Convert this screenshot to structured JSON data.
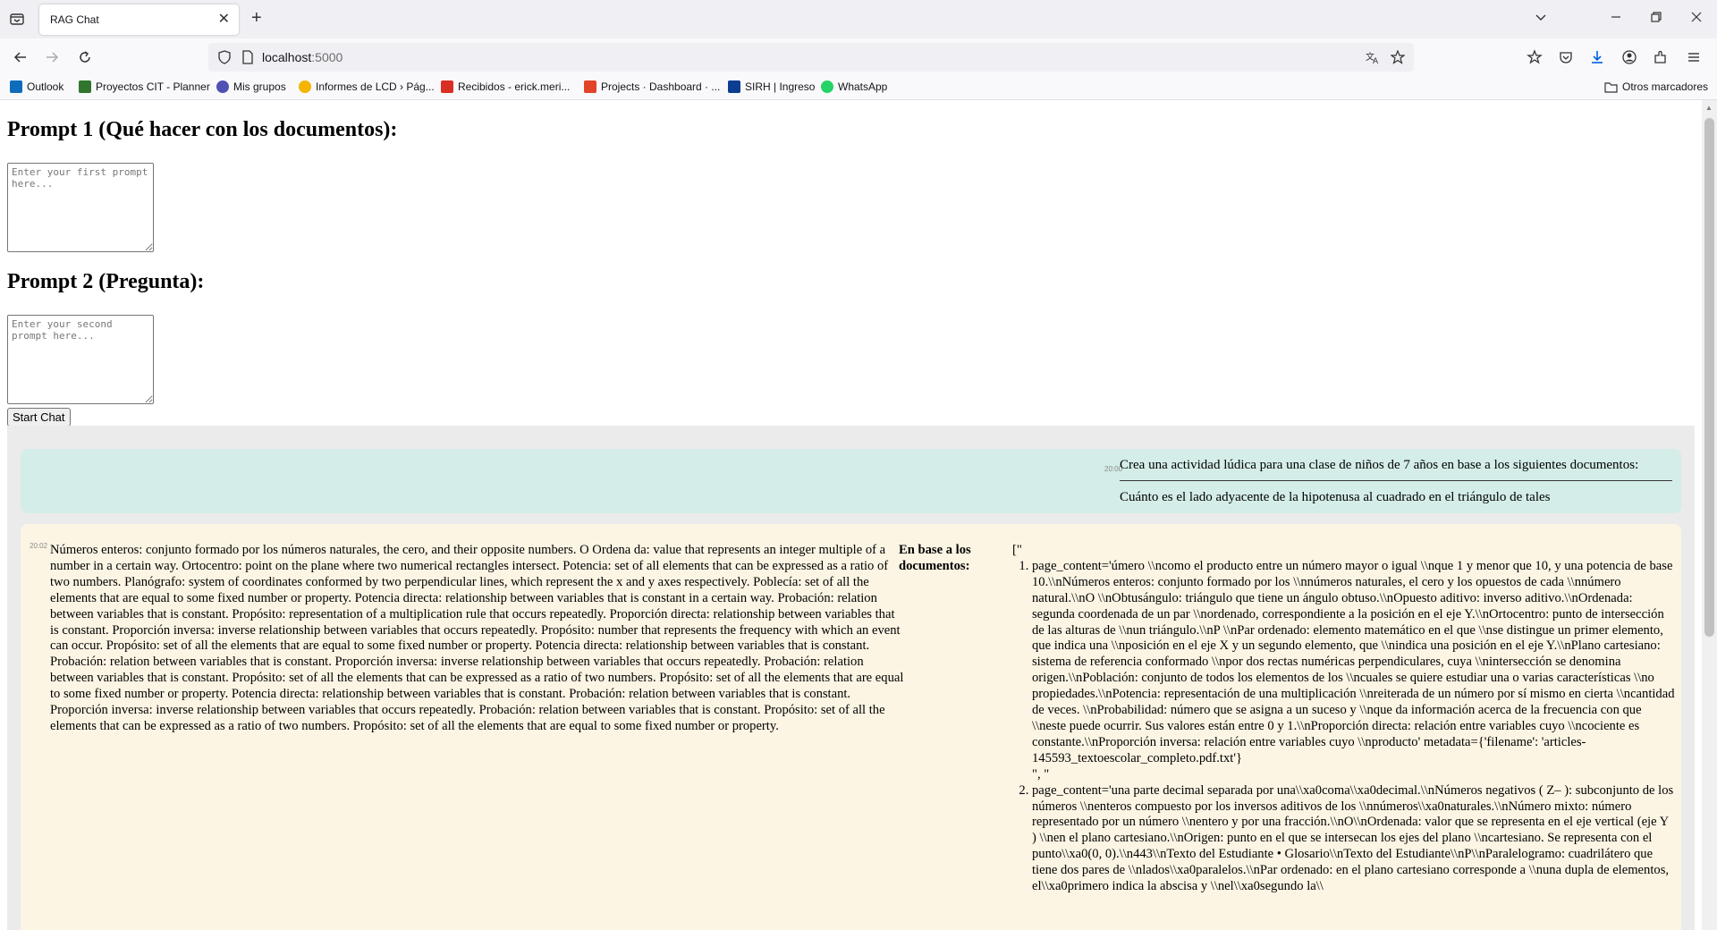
{
  "browser": {
    "tab_title": "RAG Chat",
    "url_host": "localhost",
    "url_port": ":5000",
    "bookmarks": [
      {
        "label": "Outlook",
        "icon": "outlook-icon",
        "color": "#0f6cbd"
      },
      {
        "label": "Proyectos CIT - Planner",
        "icon": "planner-icon",
        "color": "#31752f"
      },
      {
        "label": "Mis grupos",
        "icon": "groups-icon",
        "color": "#4f52b2"
      },
      {
        "label": "Informes de LCD › Pág...",
        "icon": "looker-icon",
        "color": "#f4b400"
      },
      {
        "label": "Recibidos - erick.meri...",
        "icon": "gmail-icon",
        "color": "#d93025"
      },
      {
        "label": "Projects · Dashboard · ...",
        "icon": "gitlab-icon",
        "color": "#e24329"
      },
      {
        "label": "SIRH | Ingreso",
        "icon": "sirh-icon",
        "color": "#0b3d91"
      },
      {
        "label": "WhatsApp",
        "icon": "whatsapp-icon",
        "color": "#25d366"
      }
    ],
    "other_bookmarks": "Otros marcadores"
  },
  "form": {
    "prompt1_label": "Prompt 1 (Qué hacer con los documentos):",
    "prompt1_placeholder": "Enter your first prompt here...",
    "prompt2_label": "Prompt 2 (Pregunta):",
    "prompt2_placeholder": "Enter your second prompt here...",
    "start_button": "Start Chat"
  },
  "chat": {
    "user_message": {
      "time": "20:00",
      "line1": "Crea una actividad lúdica para una clase de niños de 7 años en base a los siguientes documentos:",
      "line2": "Cuánto es el lado adyacente de la hipotenusa al cuadrado en el triángulo de tales"
    },
    "bot_message": {
      "time": "20:02",
      "answer": "Números enteros: conjunto formado por los números naturales, the cero, and their opposite numbers. O Ordena da: value that represents an integer multiple of a number in a certain way. Ortocentro: point on the plane where two numerical rectangles intersect. Potencia: set of all elements that can be expressed as a ratio of two numbers. Planógrafo: system of coordinates conformed by two perpendicular lines, which represent the x and y axes respectively. Poblecía: set of all the elements that are equal to some fixed number or property. Potencia directa: relationship between variables that is constant in a certain way. Probación: relation between variables that is constant. Propósito: representation of a multiplication rule that occurs repeatedly. Proporción directa: relationship between variables that is constant. Proporción inversa: inverse relationship between variables that occurs repeatedly. Propósito: number that represents the frequency with which an event can occur. Propósito: set of all the elements that are equal to some fixed number or property. Potencia directa: relationship between variables that is constant. Probación: relation between variables that is constant. Proporción inversa: inverse relationship between variables that occurs repeatedly. Probación: relation between variables that is constant. Propósito: set of all the elements that can be expressed as a ratio of two numbers. Propósito: set of all the elements that are equal to some fixed number or property. Potencia directa: relationship between variables that is constant. Probación: relation between variables that is constant. Proporción inversa: inverse relationship between variables that occurs repeatedly. Probación: relation between variables that is constant. Propósito: set of all the elements that can be expressed as a ratio of two numbers. Propósito: set of all the elements that are equal to some fixed number or property.",
      "docs_label": "En base a los documentos:",
      "docs_open": "[\"",
      "documents": [
        {
          "text": "page_content='úmero \\\\ncomo el producto entre un número mayor o igual \\\\nque 1 y menor que 10, y una potencia de base 10.\\\\nNúmeros enteros: conjunto formado por los \\\\nnúmeros naturales, el cero y los opuestos de cada \\\\nnúmero natural.\\\\nO \\\\nObtusángulo: triángulo que tiene un ángulo obtuso.\\\\nOpuesto aditivo: inverso aditivo.\\\\nOrdenada: segunda coordenada de un par \\\\nordenado, correspondiente a la posición en el eje Y.\\\\nOrtocentro: punto de intersección de las alturas de \\\\nun triángulo.\\\\nP \\\\nPar ordenado: elemento matemático en el que \\\\nse distingue un primer elemento, que indica una \\\\nposición en el eje X y un segundo elemento, que \\\\nindica una posición en el eje Y.\\\\nPlano cartesiano: sistema de referencia conformado \\\\npor dos rectas numéricas perpendiculares, cuya \\\\nintersección se denomina origen.\\\\nPoblación: conjunto de todos los elementos de los \\\\ncuales se quiere estudiar una o varias características \\\\no propiedades.\\\\nPotencia: representación de una multiplicación \\\\nreiterada de un número por sí mismo en cierta \\\\ncantidad de veces. \\\\nProbabilidad: número que se asigna a un suceso y \\\\nque da información acerca de la frecuencia con que \\\\neste puede ocurrir. Sus valores están entre 0 y 1.\\\\nProporción directa: relación entre variables cuyo \\\\ncociente es constante.\\\\nProporción inversa: relación entre variables cuyo \\\\nproducto' metadata={'filename': 'articles-145593_textoescolar_completo.pdf.txt'}",
          "sep": "\", \""
        },
        {
          "text": "page_content='una parte decimal separada por una\\\\xa0coma\\\\xa0decimal.\\\\nNúmeros negativos ( Z– ): subconjunto de los números \\\\nenteros compuesto por los inversos aditivos de los \\\\nnúmeros\\\\xa0naturales.\\\\nNúmero mixto: número representado por un número \\\\nentero y por una fracción.\\\\nO\\\\nOrdenada: valor que se representa en el eje vertical (eje Y ) \\\\nen el plano cartesiano.\\\\nOrigen: punto en el que se intersecan los ejes del plano \\\\ncartesiano. Se representa con el punto\\\\xa0(0, 0).\\\\n443\\\\nTexto del Estudiante • Glosario\\\\nTexto del Estudiante\\\\nP\\\\nParalelogramo: cuadrilátero que tiene dos pares de \\\\nlados\\\\xa0paralelos.\\\\nPar ordenado: en el plano cartesiano corresponde a \\\\nuna dupla de elementos, el\\\\xa0primero indica la abscisa y \\\\nel\\\\xa0segundo la\\\\",
          "sep": ""
        }
      ]
    }
  }
}
